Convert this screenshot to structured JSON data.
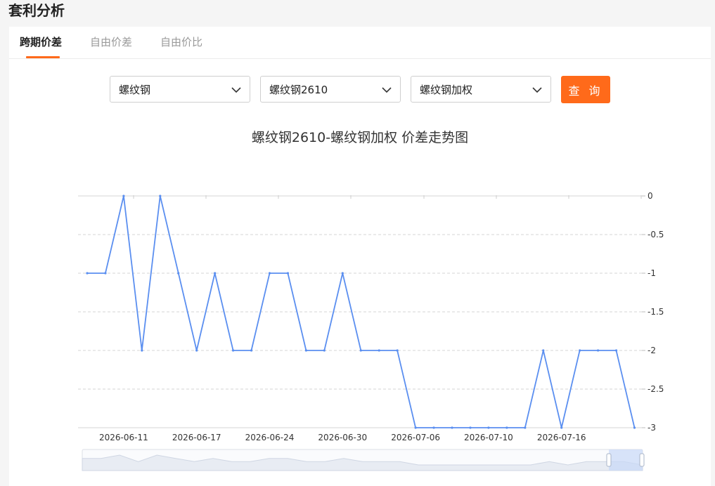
{
  "page": {
    "title": "套利分析"
  },
  "tabs": [
    {
      "label": "跨期价差",
      "active": true
    },
    {
      "label": "自由价差",
      "active": false
    },
    {
      "label": "自由价比",
      "active": false
    }
  ],
  "filters": {
    "variety": "螺纹钢",
    "contract1": "螺纹钢2610",
    "contract2": "螺纹钢加权",
    "query_label": "查 询"
  },
  "colors": {
    "accent": "#ff6a1a",
    "line": "#5b8ff0"
  },
  "chart_data": {
    "type": "line",
    "title": "螺纹钢2610-螺纹钢加权 价差走势图",
    "ylim": [
      -3,
      0
    ],
    "yticks": [
      "0",
      "-0.5",
      "-1",
      "-1.5",
      "-2",
      "-2.5",
      "-3"
    ],
    "ytick_values": [
      0,
      -0.5,
      -1,
      -1.5,
      -2,
      -2.5,
      -3
    ],
    "xtick_labels": [
      "2026-06-11",
      "2026-06-17",
      "2026-06-24",
      "2026-06-30",
      "2026-07-06",
      "2026-07-10",
      "2026-07-16"
    ],
    "xtick_index": [
      2,
      6,
      10,
      14,
      18,
      22,
      26
    ],
    "y_axis_position": "right",
    "grid": "horizontal dashed",
    "series": [
      {
        "values": [
          -1,
          -1,
          0,
          -2,
          0,
          -1,
          -2,
          -1,
          -2,
          -2,
          -1,
          -1,
          -2,
          -2,
          -1,
          -2,
          -2,
          -2,
          -3,
          -3,
          -3,
          -3,
          -3,
          -3,
          -3,
          -2,
          -3,
          -2,
          -2,
          -2,
          -3
        ]
      }
    ],
    "data_zoom": true
  }
}
